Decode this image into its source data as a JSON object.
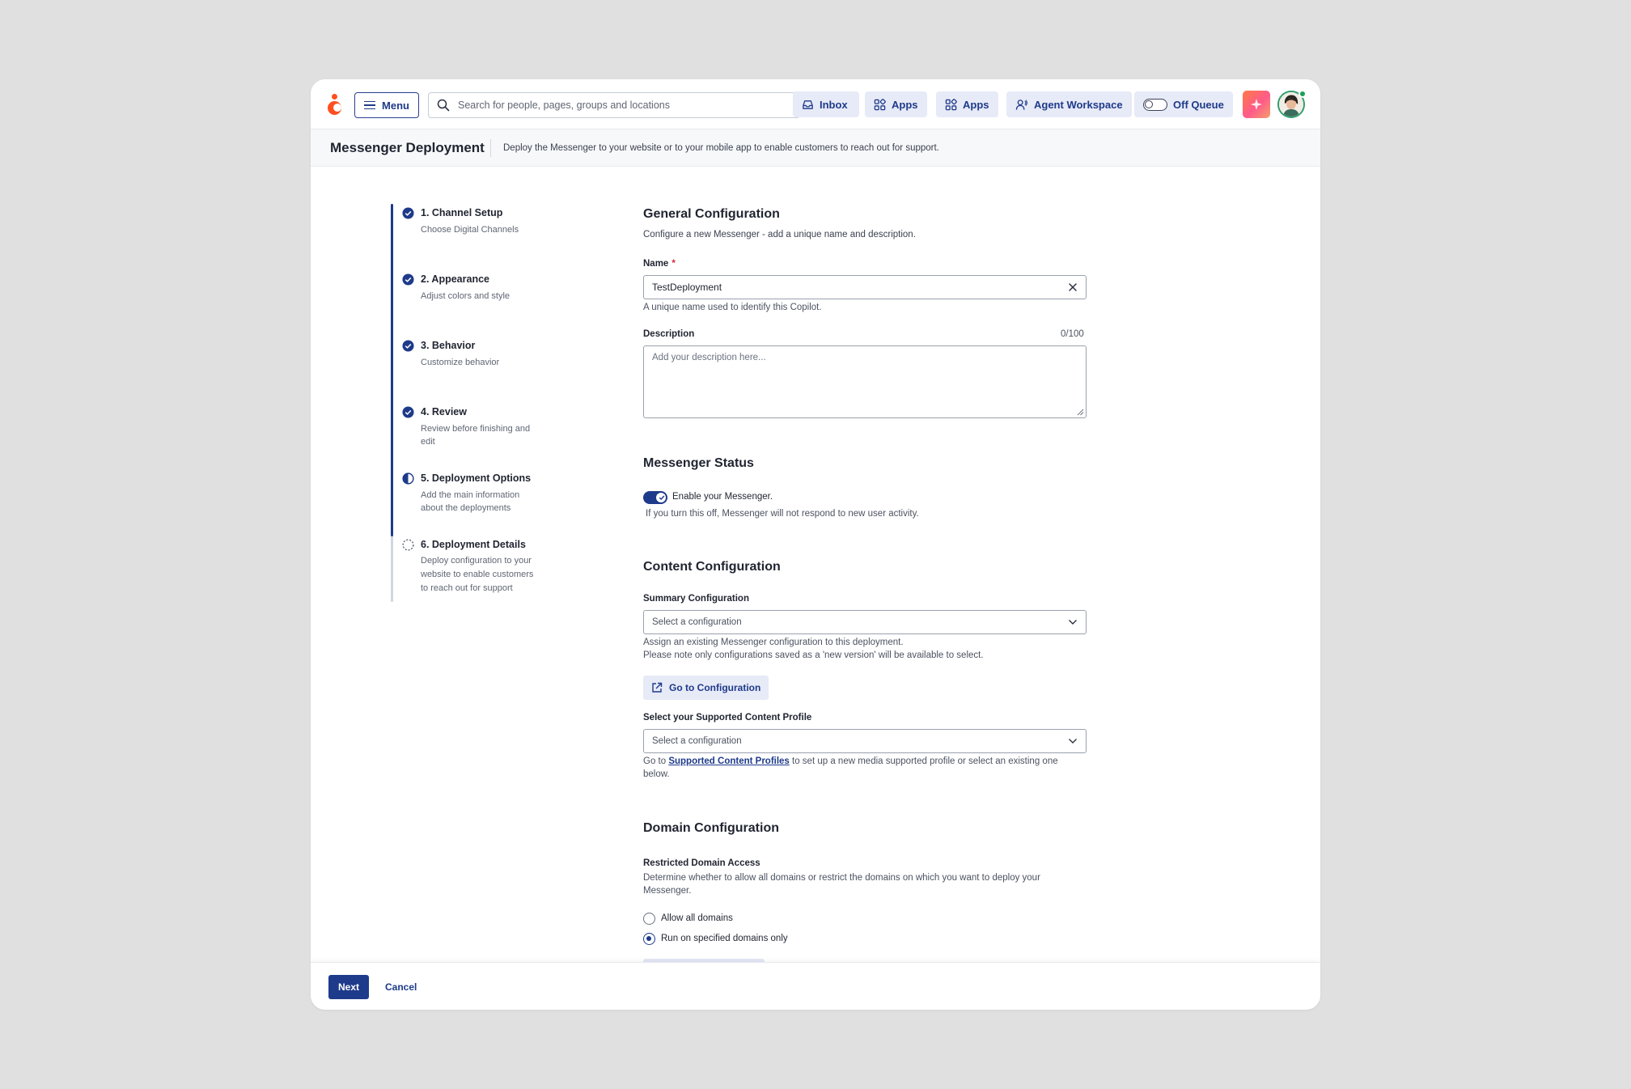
{
  "topbar": {
    "menu_label": "Menu",
    "search_placeholder": "Search for people, pages, groups and locations",
    "inbox_label": "Inbox",
    "apps_label_1": "Apps",
    "apps_label_2": "Apps",
    "agent_workspace_label": "Agent Workspace",
    "queue_label": "Off Queue"
  },
  "header": {
    "title": "Messenger Deployment",
    "description": "Deploy the Messenger to your website or to your mobile app to enable customers to reach out for support."
  },
  "steps": [
    {
      "title": "1. Channel Setup",
      "subtitle": "Choose Digital Channels",
      "status": "complete"
    },
    {
      "title": "2. Appearance",
      "subtitle": "Adjust colors and style",
      "status": "complete"
    },
    {
      "title": "3. Behavior",
      "subtitle": "Customize behavior",
      "status": "complete"
    },
    {
      "title": "4. Review",
      "subtitle": "Review before finishing and edit",
      "status": "complete"
    },
    {
      "title": "5. Deployment Options",
      "subtitle": "Add the main information about the deployments",
      "status": "in-progress"
    },
    {
      "title": "6. Deployment Details",
      "subtitle": "Deploy configuration to your website to enable customers to reach out for support",
      "status": "not-started"
    }
  ],
  "general": {
    "heading": "General Configuration",
    "description": "Configure a new Messenger - add a unique name and description.",
    "name_label": "Name",
    "name_required": "*",
    "name_value": "TestDeployment",
    "name_help": "A unique name used to identify this Copilot.",
    "description_label": "Description",
    "description_counter": "0/100",
    "description_placeholder": "Add your description here..."
  },
  "status": {
    "heading": "Messenger Status",
    "toggle_label": "Enable your Messenger.",
    "toggle_on": true,
    "help": "If you turn this off, Messenger will not respond to new user activity."
  },
  "content": {
    "heading": "Content Configuration",
    "summary_label": "Summary Configuration",
    "summary_placeholder": "Select a configuration",
    "summary_help_1": "Assign an existing Messenger configuration to this deployment.",
    "summary_help_2": "Please note only configurations saved as a 'new version' will be available to select.",
    "go_button": "Go to Configuration",
    "profile_label": "Select your Supported Content Profile",
    "profile_placeholder": "Select a configuration",
    "profile_help_prefix": "Go to ",
    "profile_help_link": "Supported Content Profiles",
    "profile_help_suffix": " to set up a new media supported profile or select an existing one",
    "profile_help_line2": "below."
  },
  "domain": {
    "heading": "Domain Configuration",
    "restricted_label": "Restricted Domain Access",
    "restricted_help_1": "Determine whether to allow all domains or restrict the domains on which you want to deploy your",
    "restricted_help_2": "Messenger.",
    "option_all": "Allow all domains",
    "option_specified": "Run on specified domains only",
    "selected": "Run on specified domains only"
  },
  "footer": {
    "next_label": "Next",
    "cancel_label": "Cancel"
  },
  "colors": {
    "accent": "#1e3a8a",
    "logo": "#ff4f1f",
    "pill_bg": "#e7eaf7"
  }
}
